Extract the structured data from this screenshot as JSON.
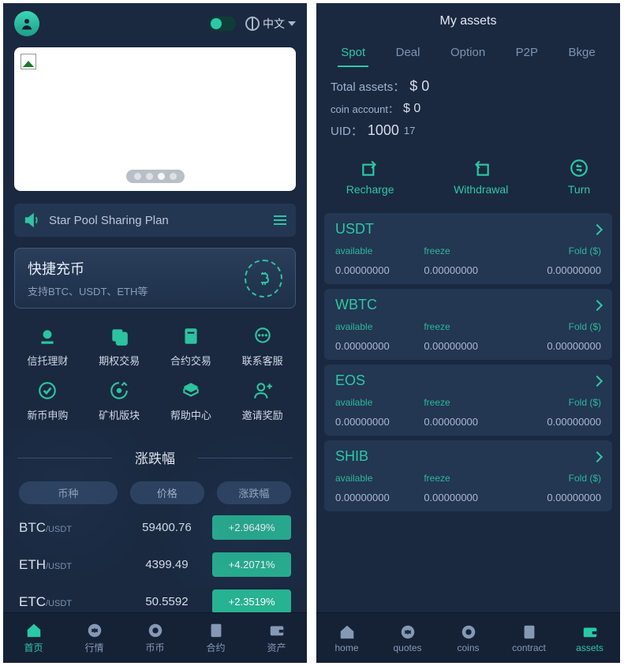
{
  "left": {
    "lang": "中文",
    "announce": "Star Pool Sharing Plan",
    "quick": {
      "title": "快捷充币",
      "sub": "支持BTC、USDT、ETH等"
    },
    "grid": [
      "信托理财",
      "期权交易",
      "合约交易",
      "联系客服",
      "新币申购",
      "矿机版块",
      "帮助中心",
      "邀请奖励"
    ],
    "section": "涨跌幅",
    "th": [
      "币种",
      "价格",
      "涨跌幅"
    ],
    "rows": [
      {
        "base": "BTC",
        "quote": "/USDT",
        "price": "59400.76",
        "chg": "+2.9649%"
      },
      {
        "base": "ETH",
        "quote": "/USDT",
        "price": "4399.49",
        "chg": "+4.2071%"
      },
      {
        "base": "ETC",
        "quote": "/USDT",
        "price": "50.5592",
        "chg": "+2.3519%"
      }
    ],
    "tabs": [
      "首页",
      "行情",
      "币币",
      "合约",
      "资产"
    ]
  },
  "right": {
    "title": "My assets",
    "tabs": [
      "Spot",
      "Deal",
      "Option",
      "P2P",
      "Bkge"
    ],
    "totalLabel": "Total assets：",
    "totalVal": "$ 0",
    "coinLabel": "coin account：",
    "coinVal": "$ 0",
    "uidLabel": "UID：",
    "uidA": "1000",
    "uidB": "17",
    "actions": [
      "Recharge",
      "Withdrawal",
      "Turn"
    ],
    "colhdr": [
      "available",
      "freeze",
      "Fold ($)"
    ],
    "coins": [
      {
        "name": "USDT",
        "a": "0.00000000",
        "f": "0.00000000",
        "v": "0.00000000"
      },
      {
        "name": "WBTC",
        "a": "0.00000000",
        "f": "0.00000000",
        "v": "0.00000000"
      },
      {
        "name": "EOS",
        "a": "0.00000000",
        "f": "0.00000000",
        "v": "0.00000000"
      },
      {
        "name": "SHIB",
        "a": "0.00000000",
        "f": "0.00000000",
        "v": "0.00000000"
      }
    ],
    "tabs2": [
      "home",
      "quotes",
      "coins",
      "contract",
      "assets"
    ]
  }
}
